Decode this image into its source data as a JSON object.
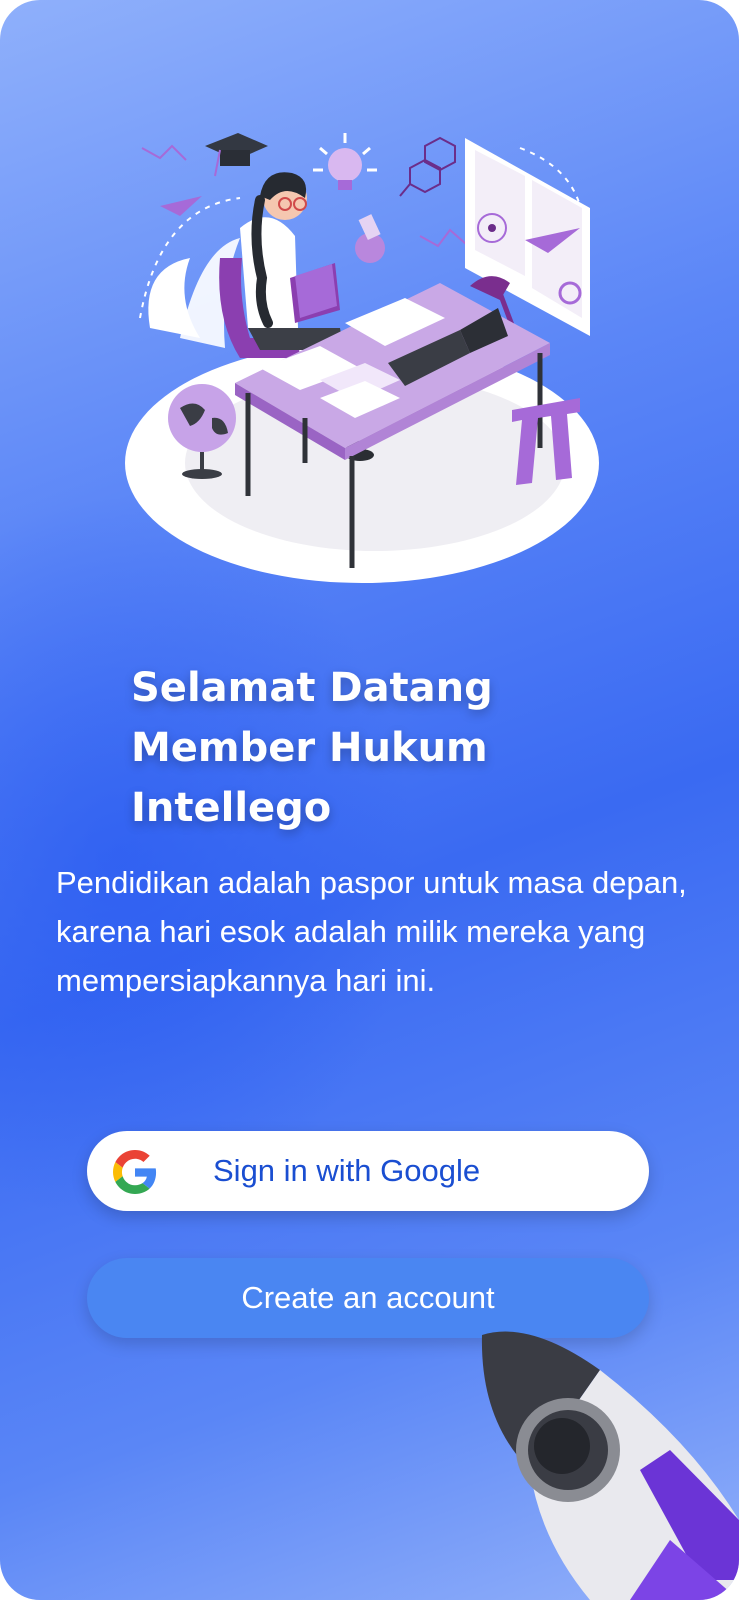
{
  "welcome": {
    "title_lines": [
      "Selamat Datang",
      "Member Hukum",
      "Intellego"
    ],
    "subtitle": "Pendidikan adalah paspor untuk masa depan, karena hari esok adalah milik mereka yang mempersiapkannya hari ini."
  },
  "actions": {
    "google_label": "Sign in with Google",
    "create_label": "Create an account"
  },
  "icons": {
    "google": "google-g-icon",
    "hero": "studying-woman-illustration",
    "rocket": "rocket-illustration"
  },
  "colors": {
    "background_primary": "#3a6af2",
    "google_text": "#1a4ed1",
    "create_button": "#4a86f2",
    "illustration_accent": "#a66ad8"
  }
}
